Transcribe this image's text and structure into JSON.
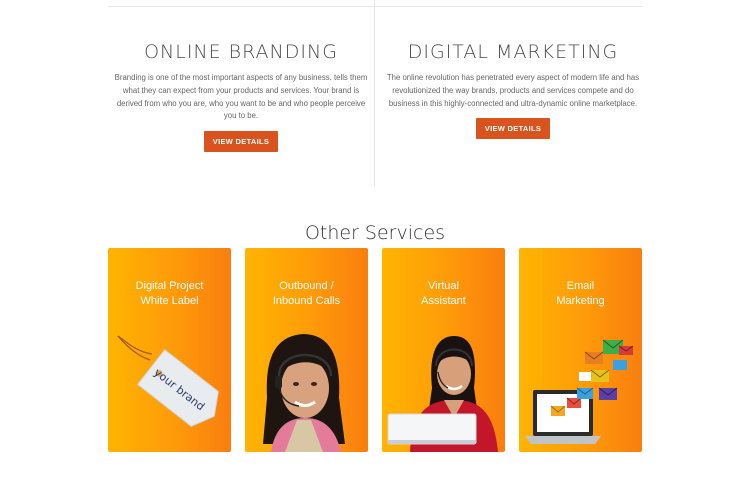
{
  "features": [
    {
      "title": "ONLINE BRANDING",
      "text": "Branding  is one of the most important aspects of any business. tells them what they can expect from your products and services. Your brand is derived from who you are, who you want to be and who people perceive you to be.",
      "button": "VIEW DETAILS"
    },
    {
      "title": "DIGITAL MARKETING",
      "text": "The online revolution has penetrated every aspect of modern life and has revolutionized the way brands, products and services compete and do business in this highly-connected and ultra-dynamic online marketplace.",
      "button": "VIEW DETAILS"
    }
  ],
  "other_services": {
    "title": "Other Services",
    "cards": [
      {
        "line1": "Digital Project",
        "line2": "White Label",
        "tag_text": "your brand",
        "icon": "brand-tag-icon"
      },
      {
        "line1": "Outbound /",
        "line2": "Inbound Calls",
        "icon": "call-center-agent-image"
      },
      {
        "line1": "Virtual",
        "line2": "Assistant",
        "icon": "virtual-assistant-image"
      },
      {
        "line1": "Email",
        "line2": "Marketing",
        "icon": "email-laptop-icon"
      }
    ]
  },
  "colors": {
    "accent": "#d9531e",
    "card_start": "#ffb400",
    "card_end": "#f97e0e"
  }
}
